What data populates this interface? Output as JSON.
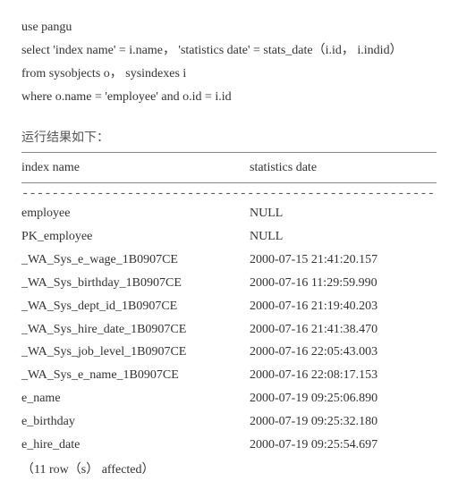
{
  "code": {
    "line1": "use pangu",
    "line2": "select 'index name' = i.name，   'statistics date' = stats_date（i.id，   i.indid）",
    "line3": "from sysobjects o，   sysindexes i",
    "line4": "where o.name = 'employee' and o.id = i.id"
  },
  "result_label": "运行结果如下：",
  "headers": {
    "col1": "index name",
    "col2": "statistics date"
  },
  "dashes": "---------------------------------------------------------------------------------------------------------",
  "rows": [
    {
      "name": "employee",
      "date": "NULL"
    },
    {
      "name": "PK_employee",
      "date": " NULL"
    },
    {
      "name": "_WA_Sys_e_wage_1B0907CE",
      "date": "2000-07-15 21:41:20.157"
    },
    {
      "name": "_WA_Sys_birthday_1B0907CE",
      "date": "2000-07-16 11:29:59.990"
    },
    {
      "name": "_WA_Sys_dept_id_1B0907CE",
      "date": "2000-07-16 21:19:40.203"
    },
    {
      "name": "_WA_Sys_hire_date_1B0907CE",
      "date": " 2000-07-16 21:41:38.470"
    },
    {
      "name": "_WA_Sys_job_level_1B0907CE",
      "date": " 2000-07-16 22:05:43.003"
    },
    {
      "name": "_WA_Sys_e_name_1B0907CE",
      "date": "2000-07-16 22:08:17.153"
    },
    {
      "name": "e_name",
      "date": "2000-07-19 09:25:06.890"
    },
    {
      "name": "e_birthday",
      "date": " 2000-07-19 09:25:32.180"
    },
    {
      "name": "e_hire_date",
      "date": "2000-07-19 09:25:54.697"
    }
  ],
  "footer": "（11 row（s）  affected）"
}
